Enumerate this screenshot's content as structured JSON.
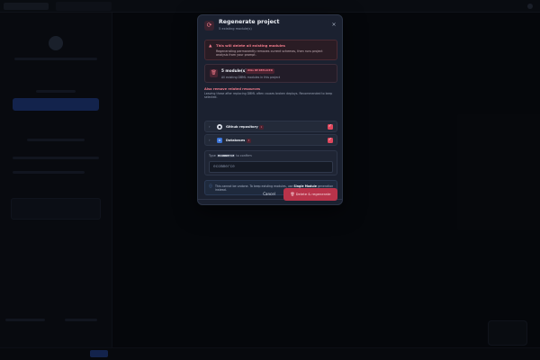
{
  "modal": {
    "title": "Regenerate project",
    "subtitle": "5 existing module(s)",
    "icon": "refresh-icon",
    "close": "×"
  },
  "warning": {
    "title": "This will delete all existing modules",
    "text": "Regenerating permanently removes current schemas, then runs project analysis from your prompt."
  },
  "modules": {
    "count": "5 module(s)",
    "badge": "WILL BE REPLACED",
    "description": "All existing DBML modules in this project"
  },
  "related": {
    "title": "Also remove related resources",
    "description": "Leaving these after replacing DBML often causes broken deploys. Recommended to keep selected.",
    "items": [
      {
        "label": "Github repository",
        "count": "1",
        "icon": "github-icon",
        "checked": true
      },
      {
        "label": "Databases",
        "count": "3",
        "icon": "database-icon",
        "checked": true
      }
    ]
  },
  "confirm": {
    "prefix": "Type",
    "code": "ecommerce",
    "suffix": "to confirm",
    "placeholder": "ecommerce"
  },
  "info": {
    "text_before": "This cannot be undone. To keep existing modules, use",
    "bold": "Single Module",
    "text_after": "generation instead."
  },
  "buttons": {
    "cancel": "Cancel",
    "danger": "Delete & regenerate"
  },
  "colors": {
    "danger": "#e0475d",
    "accent": "#2a4ea8"
  }
}
